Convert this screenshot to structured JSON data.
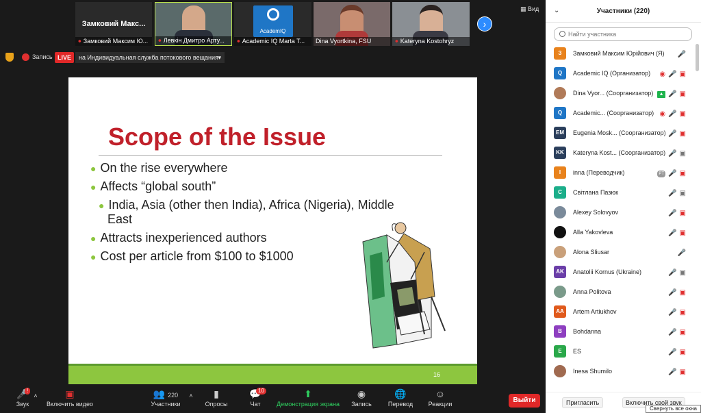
{
  "strip": {
    "tiles": [
      {
        "big": "Замковий  Макс...",
        "name": "Замковий Максим Ю..."
      },
      {
        "name": "Левкін Дмитро Арту..."
      },
      {
        "name": "Academic IQ Marta T...",
        "logo": "AcademIQ"
      },
      {
        "name": "Dina Vyortkina, FSU"
      },
      {
        "name": "Kateryna Kostohryz"
      }
    ],
    "view_label": "Вид",
    "next_icon": "chevron-right-icon"
  },
  "recording": {
    "label": "Запись",
    "live": "LIVE",
    "stream": "на Индивидуальная служба потокового вещания"
  },
  "slide": {
    "title": "Scope of the Issue",
    "bullets": [
      "On the rise everywhere",
      "Affects “global south”",
      "India, Asia (other then India), Africa (Nigeria), Middle",
      "East",
      "Attracts inexperienced authors",
      "Cost per article from $100 to $1000"
    ],
    "page": "16"
  },
  "toolbar": {
    "sound": "Звук",
    "video": "Включить видео",
    "participants": "Участники",
    "participants_count": "220",
    "polls": "Опросы",
    "chat": "Чат",
    "chat_badge": "10",
    "share": "Демонстрация экрана",
    "record": "Запись",
    "translate": "Перевод",
    "reactions": "Реакции",
    "leave": "Выйти"
  },
  "panel": {
    "title": "Участники (220)",
    "search_placeholder": "Найти участника",
    "invite": "Пригласить",
    "unmute": "Включить свой звук",
    "tooltip": "Свернуть все окна",
    "participants": [
      {
        "initials": "З",
        "color": "#e8821c",
        "name": "Замковий Максим Юрійович (Я)",
        "icons": [
          "mic-off"
        ]
      },
      {
        "initials": "Q",
        "color": "#1f76c6",
        "name": "Academic IQ (Организатор)",
        "icons": [
          "rec",
          "mic-off",
          "cam-off"
        ]
      },
      {
        "initials": "",
        "color": "#b07a58",
        "name": "Dina Vyor... (Соорганизатор)",
        "photo": true,
        "icons": [
          "share",
          "mic-on",
          "cam-off"
        ]
      },
      {
        "initials": "Q",
        "color": "#1f76c6",
        "name": "Academic... (Соорганизатор)",
        "icons": [
          "rec",
          "mic-off",
          "cam-off"
        ]
      },
      {
        "initials": "EM",
        "color": "#2b3f5c",
        "name": "Eugenia Mosk... (Соорганизатор)",
        "icons": [
          "mic-off",
          "cam-off"
        ]
      },
      {
        "initials": "KK",
        "color": "#2b3f5c",
        "name": "Kateryna Kost... (Соорганизатор)",
        "icons": [
          "mic-off",
          "cam-on"
        ]
      },
      {
        "initials": "I",
        "color": "#e8821c",
        "name": "inna (Переводчик)",
        "icons": [
          "tr",
          "mic-on",
          "cam-off"
        ]
      },
      {
        "initials": "С",
        "color": "#1cae8a",
        "name": " Світлана Пазюк",
        "icons": [
          "mic-off",
          "cam-on"
        ]
      },
      {
        "initials": "",
        "color": "#7a8a9a",
        "name": "Alexey Solovyov",
        "photo": true,
        "icons": [
          "mic-off",
          "cam-off"
        ]
      },
      {
        "initials": "",
        "color": "#111111",
        "name": "Alla Yakovleva",
        "photo": true,
        "icons": [
          "mic-off",
          "cam-off"
        ]
      },
      {
        "initials": "",
        "color": "#c9a07a",
        "name": "Alona Sliusar",
        "photo": true,
        "icons": [
          "mic-off"
        ]
      },
      {
        "initials": "AK",
        "color": "#6b3fa8",
        "name": "Anatolii Kornus (Ukraine)",
        "icons": [
          "mic-off",
          "cam-on"
        ]
      },
      {
        "initials": "",
        "color": "#7a9a8a",
        "name": "Anna Politova",
        "photo": true,
        "icons": [
          "mic-off",
          "cam-off"
        ]
      },
      {
        "initials": "AA",
        "color": "#e05a1c",
        "name": "Artem Artiukhov",
        "icons": [
          "mic-off",
          "cam-off"
        ]
      },
      {
        "initials": "B",
        "color": "#8e3fc0",
        "name": "Bohdanna",
        "icons": [
          "mic-off",
          "cam-off"
        ]
      },
      {
        "initials": "E",
        "color": "#2aa84a",
        "name": "ES",
        "icons": [
          "mic-off",
          "cam-off"
        ]
      },
      {
        "initials": "",
        "color": "#a06a50",
        "name": "Inesa Shumilo",
        "photo": true,
        "icons": [
          "mic-off",
          "cam-off"
        ]
      }
    ]
  }
}
